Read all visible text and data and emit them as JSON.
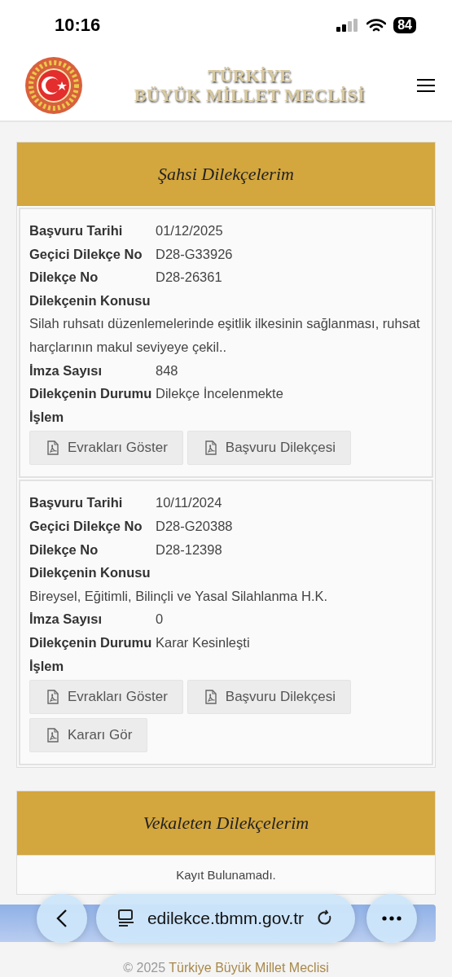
{
  "status_bar": {
    "time": "10:16",
    "battery": "84"
  },
  "header": {
    "title_line_1": "TÜRKİYE",
    "title_line_2": "BÜYÜK MİLLET MECLİSİ"
  },
  "sections": [
    {
      "title": "Şahsi Dilekçelerim",
      "petitions": [
        {
          "fields": [
            {
              "kind": "inline",
              "label": "Başvuru Tarihi",
              "value": "01/12/2025"
            },
            {
              "kind": "inline",
              "label": "Geçici Dilekçe No",
              "value": "D28-G33926"
            },
            {
              "kind": "inline",
              "label": "Dilekçe No",
              "value": "D28-26361"
            },
            {
              "kind": "stacked",
              "label": "Dilekçenin Konusu",
              "value": "Silah ruhsatı düzenlemelerinde eşitlik ilkesinin sağlanması, ruhsat harçlarının makul seviyeye çekil.."
            },
            {
              "kind": "inline",
              "label": "İmza Sayısı",
              "value": "848"
            },
            {
              "kind": "inline",
              "label": "Dilekçenin Durumu",
              "value": "Dilekçe İncelenmekte"
            }
          ],
          "action_label": "İşlem",
          "buttons": [
            "Evrakları Göster",
            "Başvuru Dilekçesi"
          ]
        },
        {
          "fields": [
            {
              "kind": "inline",
              "label": "Başvuru Tarihi",
              "value": "10/11/2024"
            },
            {
              "kind": "inline",
              "label": "Geçici Dilekçe No",
              "value": "D28-G20388"
            },
            {
              "kind": "inline",
              "label": "Dilekçe No",
              "value": "D28-12398"
            },
            {
              "kind": "stacked",
              "label": "Dilekçenin Konusu",
              "value": "Bireysel, Eğitimli, Bilinçli ve Yasal Silahlanma H.K."
            },
            {
              "kind": "inline",
              "label": "İmza Sayısı",
              "value": "0"
            },
            {
              "kind": "inline",
              "label": "Dilekçenin Durumu",
              "value": "Karar Kesinleşti"
            }
          ],
          "action_label": "İşlem",
          "buttons": [
            "Evrakları Göster",
            "Başvuru Dilekçesi",
            "Kararı Gör"
          ]
        }
      ]
    },
    {
      "title": "Vekaleten Dilekçelerim",
      "empty_text": "Kayıt Bulunamadı."
    }
  ],
  "browser": {
    "url": "edilekce.tbmm.gov.tr"
  },
  "footer": {
    "copyright": "© 2025",
    "link": "Türkiye Büyük Millet Meclisi"
  }
}
